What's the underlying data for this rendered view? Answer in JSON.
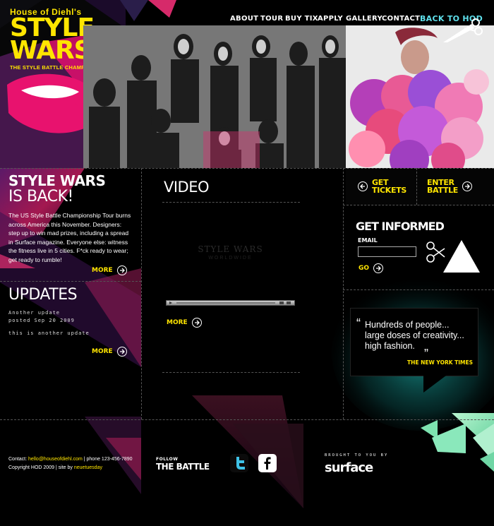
{
  "brand": {
    "top": "House of Diehl's",
    "main_line1": "STYLE",
    "main_line2": "WARS",
    "subtitle": "THE STYLE BATTLE CHAMPIONSHIPS"
  },
  "nav": {
    "items": [
      "ABOUT",
      "TOUR",
      "BUY TIX",
      "APPLY",
      "GALLERY",
      "CONTACT"
    ],
    "back": "BACK TO HOD"
  },
  "intro": {
    "title_line1": "STYLE WARS",
    "title_line2": "IS BACK!",
    "body": "The US Style Battle Championship Tour burns across America this November. Designers: step up to win mad prizes, including a spread in Surface magazine. Everyone else: witness the fitness live in 5 cities. F*ck ready to wear; get ready to rumble!",
    "more": "MORE"
  },
  "updates": {
    "title": "UPDATES",
    "item1_title": "Another update",
    "item1_posted": "posted Sep 20 2009",
    "item2_title": "this is another update",
    "more": "MORE"
  },
  "video": {
    "title": "VIDEO",
    "watermark": "STYLE WARS",
    "watermark_sub": "WORLDWIDE",
    "more": "MORE"
  },
  "sidebar": {
    "get_tickets_1": "GET",
    "get_tickets_2": "TICKETS",
    "enter_battle_1": "ENTER",
    "enter_battle_2": "BATTLE",
    "get_informed": "GET INFORMED",
    "email_label": "EMAIL",
    "email_value": "",
    "go": "GO",
    "quote_line1": "Hundreds of people...",
    "quote_line2": "large doses of creativity...",
    "quote_line3": "high fashion.",
    "quote_source": "THE NEW YORK TIMES"
  },
  "footer": {
    "contact_label": "Contact:",
    "contact_email": "hello@houseofdiehl.com",
    "contact_phone": "| phone 123-456-7890",
    "copyright": "Copyright HOD 2009 | site by",
    "site_by": "neuetuesday",
    "follow_label": "FOLLOW",
    "follow_big": "THE BATTLE",
    "brought_by": "BROUGHT TO YOU BY",
    "sponsor": "surface"
  },
  "colors": {
    "accent": "#ffe500",
    "cyan": "#5fe0ec",
    "magenta": "#e0106e",
    "teal_glow": "#1aa6a0"
  }
}
